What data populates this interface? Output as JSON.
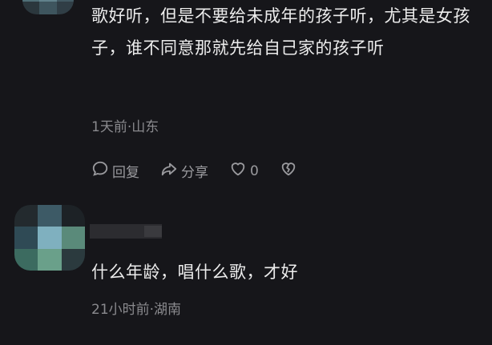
{
  "comments": [
    {
      "text": "歌好听，但是不要给未成年的孩子听，尤其是女孩子，谁不同意那就先给自己家的孩子听",
      "meta": "1天前·山东",
      "actions": {
        "reply": "回复",
        "share": "分享",
        "like_count": "0"
      }
    },
    {
      "text": "什么年龄，唱什么歌，才好",
      "meta": "21小时前·湖南"
    }
  ],
  "colors": {
    "background": "#16161a",
    "text": "#ececec",
    "meta": "#8a8a8e",
    "icon": "#9a9a9e"
  }
}
